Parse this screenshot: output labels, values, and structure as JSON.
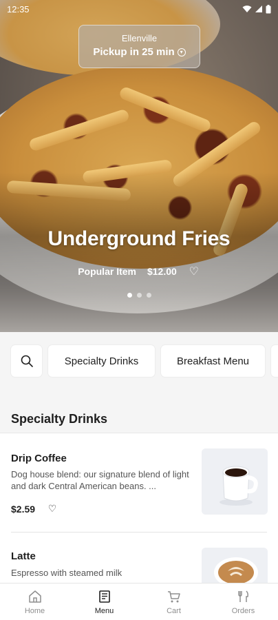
{
  "status_bar": {
    "time": "12:35"
  },
  "pickup": {
    "location": "Ellenville",
    "time_label": "Pickup in 25 min"
  },
  "hero": {
    "title": "Underground Fries",
    "tag": "Popular Item",
    "price": "$12.00",
    "carousel_pages": 3,
    "carousel_active": 1
  },
  "categories": {
    "chips": [
      "Specialty Drinks",
      "Breakfast Menu"
    ]
  },
  "section": {
    "title": "Specialty Drinks",
    "items": [
      {
        "name": "Drip Coffee",
        "description": "Dog house blend: our signature blend of light and dark Central American beans. ...",
        "price": "$2.59"
      },
      {
        "name": "Latte",
        "description": "Espresso with steamed milk"
      }
    ]
  },
  "nav": {
    "items": [
      "Home",
      "Menu",
      "Cart",
      "Orders"
    ],
    "active": "Menu"
  },
  "colors": {
    "text": "#1e1e1e",
    "muted": "#8e8e8e",
    "background": "#f5f5f5"
  }
}
